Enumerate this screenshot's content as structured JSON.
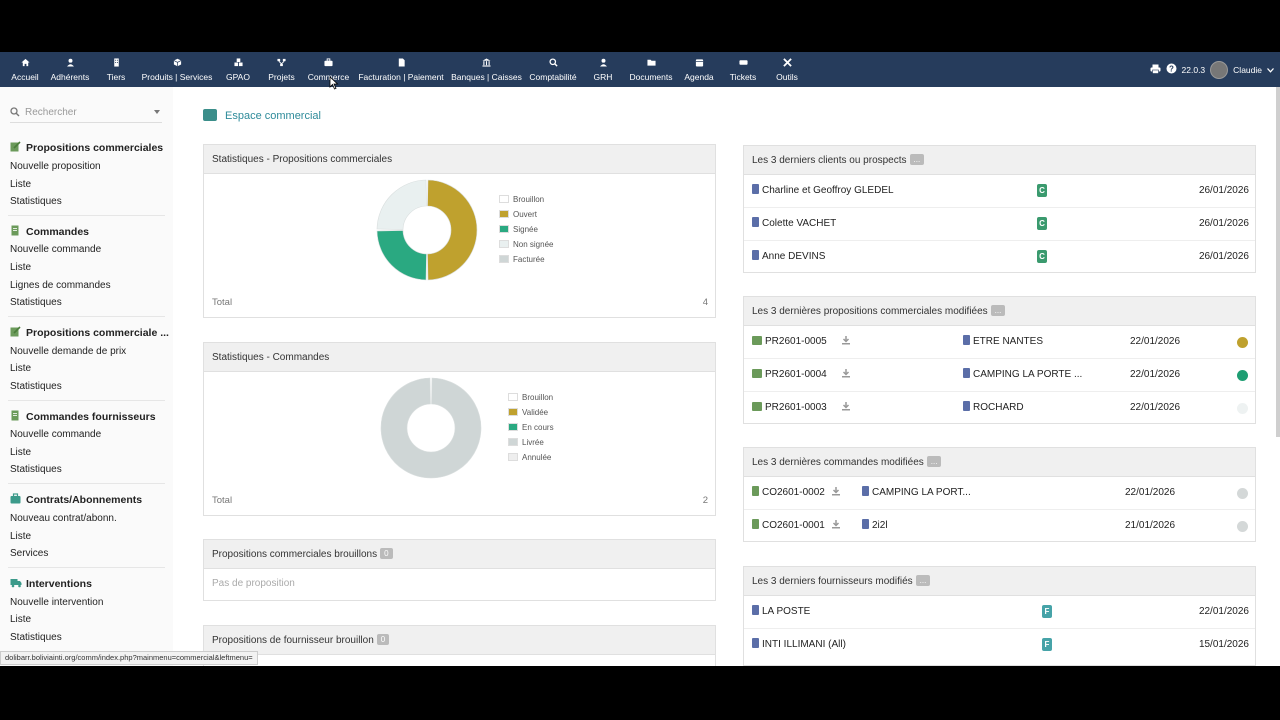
{
  "topnav": {
    "items": [
      {
        "label": "Accueil",
        "icon": "home-icon"
      },
      {
        "label": "Adhérents",
        "icon": "user-icon"
      },
      {
        "label": "Tiers",
        "icon": "building-icon"
      },
      {
        "label": "Produits | Services",
        "icon": "cube-icon"
      },
      {
        "label": "GPAO",
        "icon": "cubes-icon"
      },
      {
        "label": "Projets",
        "icon": "sitemap-icon"
      },
      {
        "label": "Commerce",
        "icon": "briefcase-icon"
      },
      {
        "label": "Facturation | Paiement",
        "icon": "file-icon"
      },
      {
        "label": "Banques | Caisses",
        "icon": "bank-icon"
      },
      {
        "label": "Comptabilité",
        "icon": "search-dollar-icon"
      },
      {
        "label": "GRH",
        "icon": "user-tie-icon"
      },
      {
        "label": "Documents",
        "icon": "folder-icon"
      },
      {
        "label": "Agenda",
        "icon": "calendar-icon"
      },
      {
        "label": "Tickets",
        "icon": "ticket-icon"
      },
      {
        "label": "Outils",
        "icon": "tools-icon"
      }
    ],
    "version": "22.0.3",
    "user": "Claudie"
  },
  "sidebar": {
    "search_placeholder": "Rechercher",
    "sections": [
      {
        "title": "Propositions commerciales",
        "links": [
          "Nouvelle proposition",
          "Liste",
          "Statistiques"
        ]
      },
      {
        "title": "Commandes",
        "links": [
          "Nouvelle commande",
          "Liste",
          "Lignes de commandes",
          "Statistiques"
        ]
      },
      {
        "title": "Propositions commerciale ...",
        "links": [
          "Nouvelle demande de prix",
          "Liste",
          "Statistiques"
        ]
      },
      {
        "title": "Commandes fournisseurs",
        "links": [
          "Nouvelle commande",
          "Liste",
          "Statistiques"
        ]
      },
      {
        "title": "Contrats/Abonnements",
        "links": [
          "Nouveau contrat/abonn.",
          "Liste",
          "Services"
        ]
      },
      {
        "title": "Interventions",
        "links": [
          "Nouvelle intervention",
          "Liste",
          "Statistiques"
        ]
      }
    ]
  },
  "page": {
    "title": "Espace commercial"
  },
  "stats_proposals": {
    "title": "Statistiques - Propositions commerciales",
    "total_label": "Total",
    "total": "4",
    "legend": [
      "Brouillon",
      "Ouvert",
      "Signée",
      "Non signée",
      "Facturée"
    ],
    "chart_data": {
      "type": "pie",
      "labels": [
        "Brouillon",
        "Ouvert",
        "Signée",
        "Non signée",
        "Facturée"
      ],
      "values": [
        0,
        2,
        1,
        1,
        0
      ],
      "colors": [
        "#ffffff",
        "#bfa12e",
        "#2aa981",
        "#e9f0f0",
        "#cfd6d6"
      ]
    }
  },
  "stats_orders": {
    "title": "Statistiques - Commandes",
    "total_label": "Total",
    "total": "2",
    "legend": [
      "Brouillon",
      "Validée",
      "En cours",
      "Livrée",
      "Annulée"
    ],
    "chart_data": {
      "type": "pie",
      "labels": [
        "Brouillon",
        "Validée",
        "En cours",
        "Livrée",
        "Annulée"
      ],
      "values": [
        0,
        0,
        0,
        2,
        0
      ],
      "colors": [
        "#ffffff",
        "#bfa12e",
        "#2aa981",
        "#cfd6d6",
        "#eeeeee"
      ]
    }
  },
  "draft_proposals": {
    "title": "Propositions commerciales brouillons",
    "count": "0",
    "empty": "Pas de proposition"
  },
  "draft_supplier": {
    "title": "Propositions de fournisseur brouillon",
    "count": "0"
  },
  "last_clients": {
    "title": "Les 3 derniers clients ou prospects",
    "more": "...",
    "rows": [
      {
        "name": "Charline et Geoffroy GLEDEL",
        "type": "C",
        "date": "26/01/2026"
      },
      {
        "name": "Colette VACHET",
        "type": "C",
        "date": "26/01/2026"
      },
      {
        "name": "Anne DEVINS",
        "type": "C",
        "date": "26/01/2026"
      }
    ]
  },
  "last_proposals": {
    "title": "Les 3 dernières propositions commerciales modifiées",
    "more": "...",
    "rows": [
      {
        "ref": "PR2601-0005",
        "company": "ETRE NANTES",
        "date": "22/01/2026",
        "status_color": "#bfa12e"
      },
      {
        "ref": "PR2601-0004",
        "company": "CAMPING LA PORTE ...",
        "date": "22/01/2026",
        "status_color": "#1e9e73"
      },
      {
        "ref": "PR2601-0003",
        "company": "ROCHARD",
        "date": "22/01/2026",
        "status_color": "#eef2f2"
      }
    ]
  },
  "last_orders": {
    "title": "Les 3 dernières commandes modifiées",
    "more": "...",
    "rows": [
      {
        "ref": "CO2601-0002",
        "company": "CAMPING LA PORT...",
        "date": "22/01/2026",
        "status_color": "#d4d8d8"
      },
      {
        "ref": "CO2601-0001",
        "company": "2i2l",
        "date": "21/01/2026",
        "status_color": "#d4d8d8"
      }
    ]
  },
  "last_suppliers": {
    "title": "Les 3 derniers fournisseurs modifiés",
    "more": "...",
    "rows": [
      {
        "name": "LA POSTE",
        "type": "F",
        "date": "22/01/2026"
      },
      {
        "name": "INTI ILLIMANI (All)",
        "type": "F",
        "date": "15/01/2026"
      }
    ]
  },
  "statusbar": {
    "url": "dolibarr.boliviainti.org/comm/index.php?mainmenu=commercial&leftmenu="
  },
  "colors": {
    "topbar": "#263c5c",
    "accent": "#2e8b9a",
    "client_tag": "#3a9a6e",
    "supplier_tag": "#46a3a8"
  }
}
